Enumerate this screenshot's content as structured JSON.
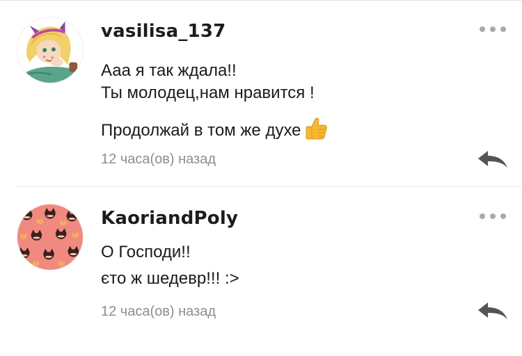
{
  "comments": [
    {
      "username": "vasilisa_137",
      "avatar": "cartoon-girl-avatar",
      "lines": [
        "Ааа я так ждала!!",
        "Ты молодец,нам нравится !",
        "Продолжай в том же духе"
      ],
      "emoji": "thumbs-up-emoji",
      "timestamp": "12 часа(ов) назад"
    },
    {
      "username": "KaoriandPoly",
      "avatar": "cat-pattern-avatar",
      "lines": [
        "О Господи!!",
        "єто ж шедевр!!! :>"
      ],
      "timestamp": "12 часа(ов) назад"
    }
  ],
  "colors": {
    "text": "#1a1a1a",
    "muted": "#8d8d8d",
    "icon": "#a9a9a9",
    "reply_icon": "#555555",
    "avatar2_bg": "#f08a80"
  }
}
